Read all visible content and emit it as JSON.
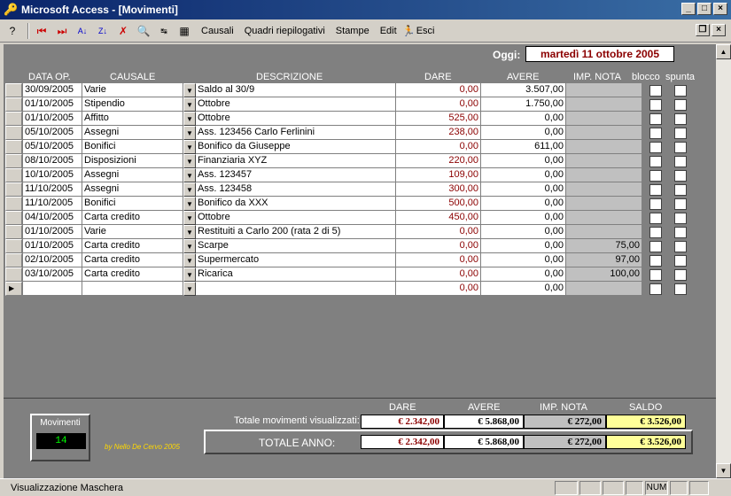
{
  "window": {
    "title": "Microsoft Access - [Movimenti]"
  },
  "menu": {
    "items": [
      "Causali",
      "Quadri riepilogativi",
      "Stampe",
      "Edit",
      "Esci"
    ]
  },
  "header": {
    "oggi_label": "Oggi:",
    "oggi_value": "martedì 11 ottobre 2005"
  },
  "columns": {
    "data": "DATA OP.",
    "causale": "CAUSALE",
    "descrizione": "DESCRIZIONE",
    "dare": "DARE",
    "avere": "AVERE",
    "nota": "IMP. NOTA",
    "blocco": "blocco",
    "spunta": "spunta"
  },
  "rows": [
    {
      "data": "30/09/2005",
      "causale": "Varie",
      "descrizione": "Saldo al 30/9",
      "dare": "0,00",
      "avere": "3.507,00",
      "nota": ""
    },
    {
      "data": "01/10/2005",
      "causale": "Stipendio",
      "descrizione": "Ottobre",
      "dare": "0,00",
      "avere": "1.750,00",
      "nota": ""
    },
    {
      "data": "01/10/2005",
      "causale": "Affitto",
      "descrizione": "Ottobre",
      "dare": "525,00",
      "avere": "0,00",
      "nota": ""
    },
    {
      "data": "05/10/2005",
      "causale": "Assegni",
      "descrizione": "Ass. 123456 Carlo Ferlinini",
      "dare": "238,00",
      "avere": "0,00",
      "nota": ""
    },
    {
      "data": "05/10/2005",
      "causale": "Bonifici",
      "descrizione": "Bonifico da Giuseppe",
      "dare": "0,00",
      "avere": "611,00",
      "nota": ""
    },
    {
      "data": "08/10/2005",
      "causale": "Disposizioni",
      "descrizione": "Finanziaria XYZ",
      "dare": "220,00",
      "avere": "0,00",
      "nota": ""
    },
    {
      "data": "10/10/2005",
      "causale": "Assegni",
      "descrizione": "Ass. 123457",
      "dare": "109,00",
      "avere": "0,00",
      "nota": ""
    },
    {
      "data": "11/10/2005",
      "causale": "Assegni",
      "descrizione": "Ass. 123458",
      "dare": "300,00",
      "avere": "0,00",
      "nota": ""
    },
    {
      "data": "11/10/2005",
      "causale": "Bonifici",
      "descrizione": "Bonifico da XXX",
      "dare": "500,00",
      "avere": "0,00",
      "nota": ""
    },
    {
      "data": "04/10/2005",
      "causale": "Carta credito",
      "descrizione": "Ottobre",
      "dare": "450,00",
      "avere": "0,00",
      "nota": ""
    },
    {
      "data": "01/10/2005",
      "causale": "Varie",
      "descrizione": "Restituiti a Carlo 200 (rata 2 di 5)",
      "dare": "0,00",
      "avere": "0,00",
      "nota": ""
    },
    {
      "data": "01/10/2005",
      "causale": "Carta credito",
      "descrizione": "Scarpe",
      "dare": "0,00",
      "avere": "0,00",
      "nota": "75,00"
    },
    {
      "data": "02/10/2005",
      "causale": "Carta credito",
      "descrizione": "Supermercato",
      "dare": "0,00",
      "avere": "0,00",
      "nota": "97,00"
    },
    {
      "data": "03/10/2005",
      "causale": "Carta credito",
      "descrizione": "Ricarica",
      "dare": "0,00",
      "avere": "0,00",
      "nota": "100,00"
    },
    {
      "data": "",
      "causale": "",
      "descrizione": "",
      "dare": "0,00",
      "avere": "0,00",
      "nota": ""
    }
  ],
  "footer": {
    "hdr_dare": "DARE",
    "hdr_avere": "AVERE",
    "hdr_nota": "IMP. NOTA",
    "hdr_saldo": "SALDO",
    "vis_label": "Totale movimenti visualizzati:",
    "vis_dare": "€ 2.342,00",
    "vis_avere": "€ 5.868,00",
    "vis_nota": "€ 272,00",
    "vis_saldo": "€ 3.526,00",
    "anno_label": "TOTALE ANNO:",
    "anno_dare": "€ 2.342,00",
    "anno_avere": "€ 5.868,00",
    "anno_nota": "€ 272,00",
    "anno_saldo": "€ 3.526,00",
    "mov_label": "Movimenti",
    "mov_value": "14",
    "credit": "by Nello De Cervo 2005"
  },
  "status": {
    "text": "Visualizzazione Maschera",
    "num": "NUM"
  }
}
